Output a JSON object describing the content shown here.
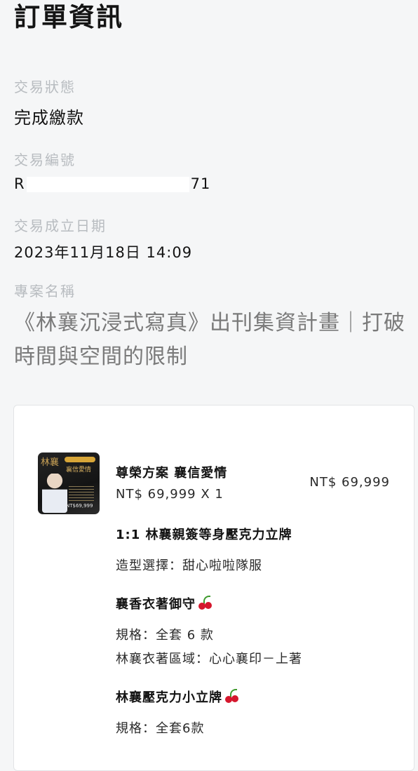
{
  "page_title": "訂單資訊",
  "fields": {
    "status_label": "交易狀態",
    "status_value": "完成繳款",
    "order_no_label": "交易編號",
    "order_no_prefix": "R",
    "order_no_suffix": "71",
    "date_label": "交易成立日期",
    "date_value": "2023年11月18日 14:09",
    "project_label": "專案名稱",
    "project_value": "《林襄沉浸式寫真》出刊集資計畫｜打破時間與空間的限制"
  },
  "plan": {
    "name": "尊榮方案 襄信愛情",
    "qty_text": "NT$ 69,999 X 1",
    "total": "NT$ 69,999",
    "thumbnail": {
      "title": "林襄",
      "subtitle": "襄信愛情",
      "price": "NT$69,999"
    }
  },
  "items": [
    {
      "title": "1:1 林襄親簽等身壓克力立牌",
      "specs": [
        "造型選擇：甜心啦啦隊服"
      ],
      "icon": null
    },
    {
      "title": "襄香衣著御守",
      "specs": [
        "規格：全套 6 款",
        "林襄衣著區域：心心襄印－上著"
      ],
      "icon": "cherry-icon"
    },
    {
      "title": "林襄壓克力小立牌",
      "specs": [
        "規格：全套6款"
      ],
      "icon": "cherry-icon"
    }
  ],
  "colors": {
    "background": "#f5f6f7",
    "label": "#b8bcc0",
    "text": "#141414",
    "project_text": "#7a7a7a",
    "card_border": "#e2e4e6"
  }
}
